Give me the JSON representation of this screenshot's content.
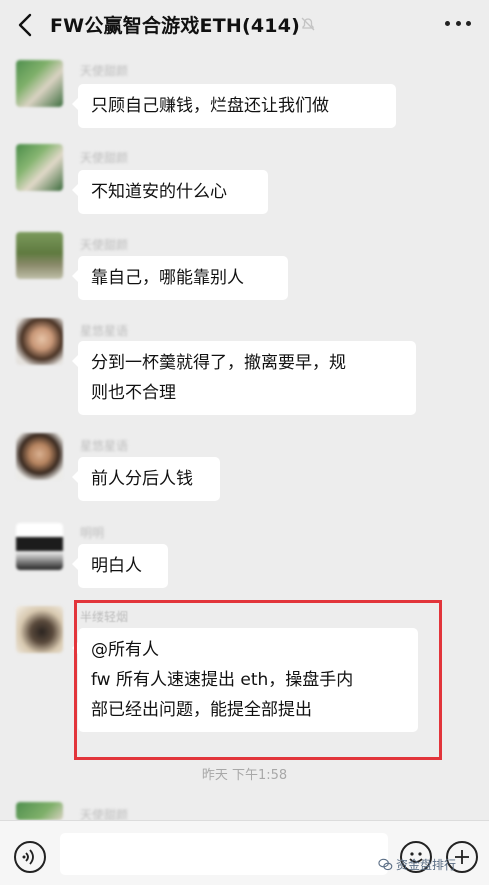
{
  "header": {
    "title": "FW公赢智合游戏ETH(414)"
  },
  "messages": [
    {
      "lines": [
        "只顾自己赚钱，烂盘还让我们做"
      ]
    },
    {
      "lines": [
        "不知道安的什么心"
      ]
    },
    {
      "lines": [
        "靠自己，哪能靠别人"
      ]
    },
    {
      "lines": [
        "分到一杯羹就得了，撤离要早，规",
        "则也不合理"
      ]
    },
    {
      "lines": [
        "前人分后人钱"
      ]
    },
    {
      "lines": [
        "明白人"
      ]
    },
    {
      "nickname": "半缕轻烟",
      "lines": [
        "@所有人",
        "fw 所有人速速提出 eth，操盘手内",
        "部已经出问题，能提全部提出"
      ]
    }
  ],
  "timestamp": "昨天 下午1:58",
  "next_nickname": "天使甜颜",
  "watermark": "资金盘排行",
  "colors": {
    "background": "#ededed",
    "bubble": "#ffffff",
    "highlight_border": "#e2353b"
  }
}
